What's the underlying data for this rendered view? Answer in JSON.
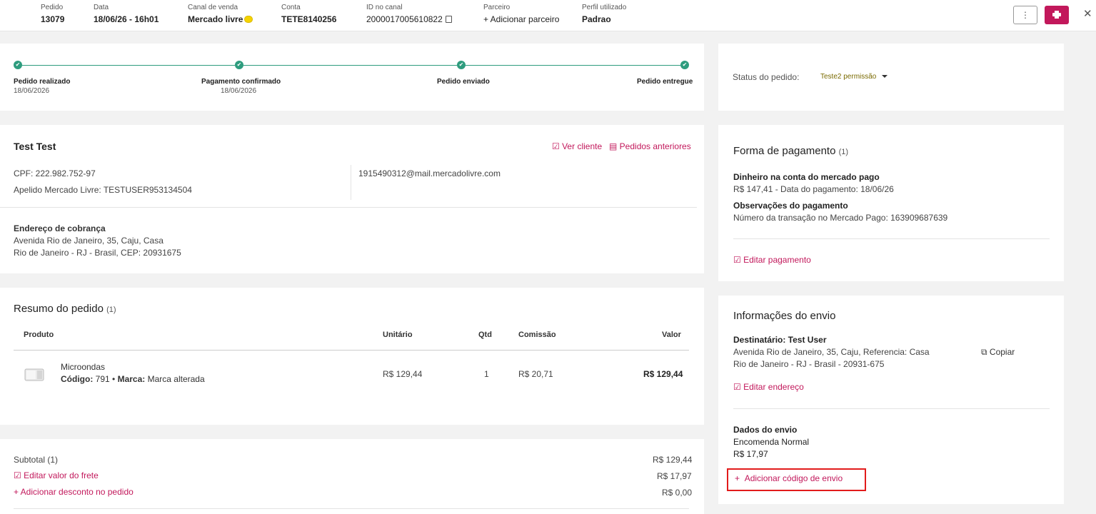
{
  "header": {
    "pedido": {
      "label": "Pedido",
      "value": "13079"
    },
    "data": {
      "label": "Data",
      "value": "18/06/26 - 16h01"
    },
    "canal": {
      "label": "Canal de venda",
      "value": "Mercado livre"
    },
    "conta": {
      "label": "Conta",
      "value": "TETE8140256"
    },
    "id_canal": {
      "label": "ID no canal",
      "value": "2000017005610822"
    },
    "parceiro": {
      "label": "Parceiro",
      "value": "+ Adicionar parceiro"
    },
    "perfil": {
      "label": "Perfil utilizado",
      "value": "Padrao"
    },
    "more_label": "⋮",
    "close_label": "✕"
  },
  "timeline": {
    "steps": [
      {
        "title": "Pedido realizado",
        "date": "18/06/2026"
      },
      {
        "title": "Pagamento confirmado",
        "date": "18/06/2026"
      },
      {
        "title": "Pedido enviado",
        "date": ""
      },
      {
        "title": "Pedido entregue",
        "date": ""
      }
    ],
    "check": "✔"
  },
  "status": {
    "label": "Status do pedido:",
    "value": "Teste2 permissão"
  },
  "customer": {
    "name": "Test Test",
    "ver_cliente": "Ver cliente",
    "pedidos_anteriores": "Pedidos anteriores",
    "cpf": "CPF: 222.982.752-97",
    "apelido": "Apelido Mercado Livre: TESTUSER953134504",
    "email": "1915490312@mail.mercadolivre.com",
    "billing_title": "Endereço de cobrança",
    "billing_line1": "Avenida Rio de Janeiro, 35, Caju, Casa",
    "billing_line2": "Rio de Janeiro - RJ - Brasil, CEP: 20931675"
  },
  "payment": {
    "title": "Forma de pagamento",
    "count": "(1)",
    "method": "Dinheiro na conta do mercado pago",
    "detail": "R$ 147,41 - Data do pagamento: 18/06/26",
    "obs_title": "Observações do pagamento",
    "obs": "Número da transação no Mercado Pago: 163909687639",
    "edit": "Editar pagamento"
  },
  "summary": {
    "title": "Resumo do pedido",
    "count": "(1)",
    "columns": {
      "produto": "Produto",
      "unitario": "Unitário",
      "qtd": "Qtd",
      "comissao": "Comissão",
      "valor": "Valor"
    },
    "item": {
      "name": "Microondas",
      "codigo_label": "Código:",
      "codigo": "791",
      "marca_label": "Marca:",
      "marca": "Marca alterada",
      "unitario": "R$ 129,44",
      "qtd": "1",
      "comissao": "R$ 20,71",
      "valor": "R$ 129,44"
    }
  },
  "totals": {
    "subtotal_label": "Subtotal (1)",
    "subtotal": "R$ 129,44",
    "frete_label": "Editar valor do frete",
    "frete": "R$ 17,97",
    "desconto_label": "+ Adicionar desconto no pedido",
    "desconto": "R$ 0,00"
  },
  "shipping": {
    "title": "Informações do envio",
    "recipient": "Destinatário: Test User",
    "addr1": "Avenida Rio de Janeiro, 35, Caju, Referencia: Casa",
    "addr2": "Rio de Janeiro - RJ - Brasil - 20931-675",
    "copy": "Copiar",
    "edit_address": "Editar endereço",
    "dados_title": "Dados do envio",
    "service": "Encomenda Normal",
    "price": "R$ 17,97",
    "add_code": "Adicionar código de envio"
  },
  "colors": {
    "accent": "#c2185b",
    "success": "#2e9c7e",
    "highlight": "#e21b1b"
  }
}
